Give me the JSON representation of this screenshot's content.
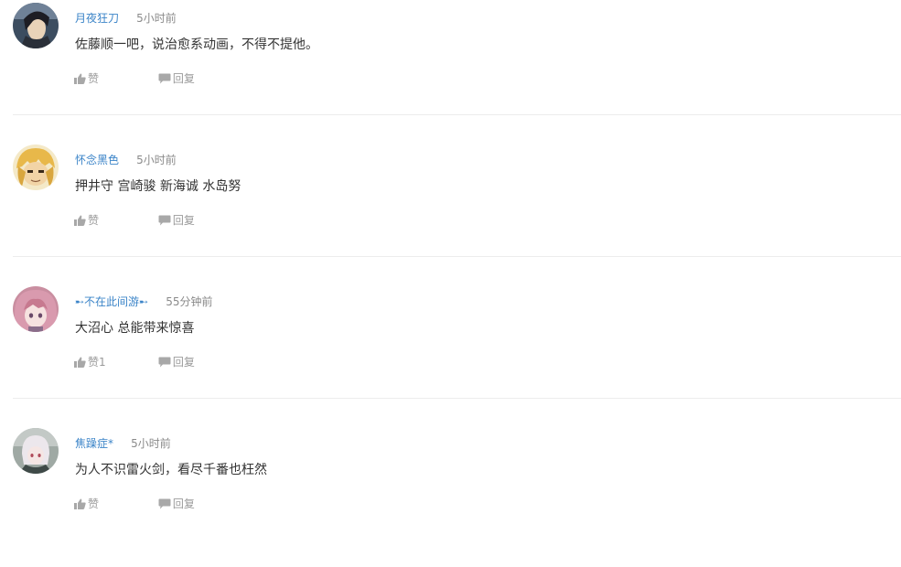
{
  "comments": [
    {
      "username": "月夜狂刀",
      "time": "5小时前",
      "content": "佐藤顺一吧，说治愈系动画，不得不提他。",
      "like_label": "赞",
      "reply_label": "回复",
      "avatar_icon": "anime-character-avatar"
    },
    {
      "username": "怀念黑色",
      "time": "5小时前",
      "content": "押井守 宫崎骏 新海诚 水岛努",
      "like_label": "赞",
      "reply_label": "回复",
      "avatar_icon": "anime-character-avatar"
    },
    {
      "username": "➸不在此间游➸",
      "time": "55分钟前",
      "content": "大沼心 总能带来惊喜",
      "like_label": "赞1",
      "reply_label": "回复",
      "avatar_icon": "anime-character-avatar"
    },
    {
      "username": "焦躁症*",
      "time": "5小时前",
      "content": "为人不识雷火剑，看尽千番也枉然",
      "like_label": "赞",
      "reply_label": "回复",
      "avatar_icon": "anime-character-avatar"
    }
  ],
  "colors": {
    "username": "#3b84c8",
    "meta_text": "#8a8a8a",
    "content_text": "#333333",
    "action_icon": "#a8a8a8",
    "divider": "#ececec"
  }
}
